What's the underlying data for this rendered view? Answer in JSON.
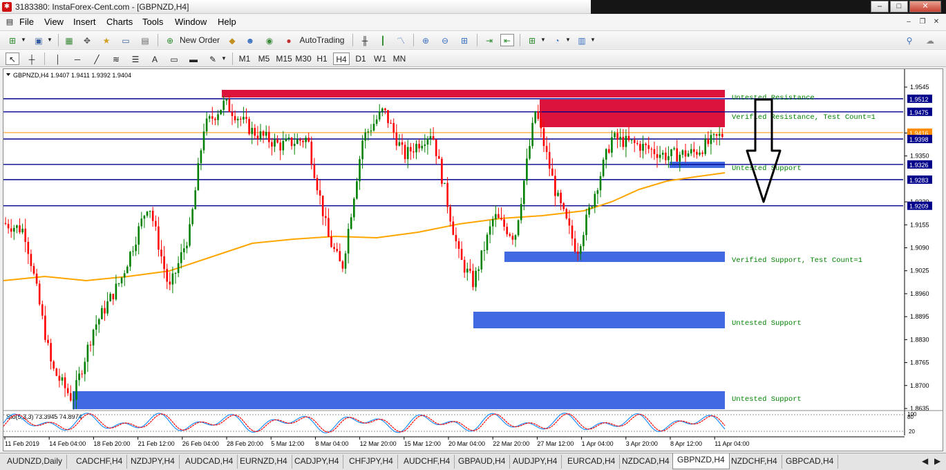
{
  "window": {
    "title": "3183380: InstaForex-Cent.com - [GBPNZD,H4]",
    "controls": [
      "–",
      "□",
      "✕"
    ]
  },
  "menu": [
    "File",
    "View",
    "Insert",
    "Charts",
    "Tools",
    "Window",
    "Help"
  ],
  "toolbar": {
    "new_order": "New Order",
    "auto_trading": "AutoTrading"
  },
  "timeframes": [
    "M1",
    "M5",
    "M15",
    "M30",
    "H1",
    "H4",
    "D1",
    "W1",
    "MN"
  ],
  "active_timeframe": "H4",
  "chart": {
    "header": "GBPNZD,H4  1.9407 1.9411 1.9392 1.9404",
    "price_labels": [
      "1.9545",
      "1.9415",
      "1.9350",
      "1.9220",
      "1.9155",
      "1.9090",
      "1.9025",
      "1.8960",
      "1.8895",
      "1.8830",
      "1.8765",
      "1.8700",
      "1.8635"
    ],
    "level_labels": [
      "1.9512",
      "1.9475",
      "1.9416",
      "1.9398",
      "1.9326",
      "1.9283",
      "1.9209"
    ],
    "zone_texts": {
      "untested_resistance": "Untested Resistance",
      "verified_resistance": "Verified Resistance, Test Count=1",
      "untested_support_1": "Untested Support",
      "verified_support": "Verified Support, Test Count=1",
      "untested_support_2": "Untested Support",
      "untested_support_3": "Untested Support"
    },
    "time_labels": [
      "11 Feb 2019",
      "14 Feb 04:00",
      "18 Feb 20:00",
      "21 Feb 12:00",
      "26 Feb 04:00",
      "28 Feb 20:00",
      "5 Mar 12:00",
      "8 Mar 04:00",
      "12 Mar 20:00",
      "15 Mar 12:00",
      "20 Mar 04:00",
      "22 Mar 20:00",
      "27 Mar 12:00",
      "1 Apr 04:00",
      "3 Apr 20:00",
      "8 Apr 12:00",
      "11 Apr 04:00"
    ],
    "indicator": {
      "label": "Sto(5,3,3) 73.3945 74.8974",
      "scale": [
        "100",
        "80",
        "20"
      ]
    },
    "colors": {
      "resistance_zone": "#dc143c",
      "support_zone": "#4169e1",
      "level_line": "#00008b",
      "ma_line": "#ffa500",
      "bull_candle": "#008000",
      "bear_candle": "#ff0000",
      "sto_main": "#1e90ff",
      "sto_signal": "#ff0000",
      "background": "#ffffff",
      "bid_line": "#ff8c00",
      "zone_text": "#008000"
    }
  },
  "tabs": [
    "AUDNZD,Daily",
    "CADCHF,H4",
    "NZDJPY,H4",
    "AUDCAD,H4",
    "EURNZD,H4",
    "CADJPY,H4",
    "CHFJPY,H4",
    "AUDCHF,H4",
    "GBPAUD,H4",
    "AUDJPY,H4",
    "EURCAD,H4",
    "NZDCAD,H4",
    "GBPNZD,H4",
    "NZDCHF,H4",
    "GBPCAD,H4"
  ],
  "active_tab": "GBPNZD,H4"
}
